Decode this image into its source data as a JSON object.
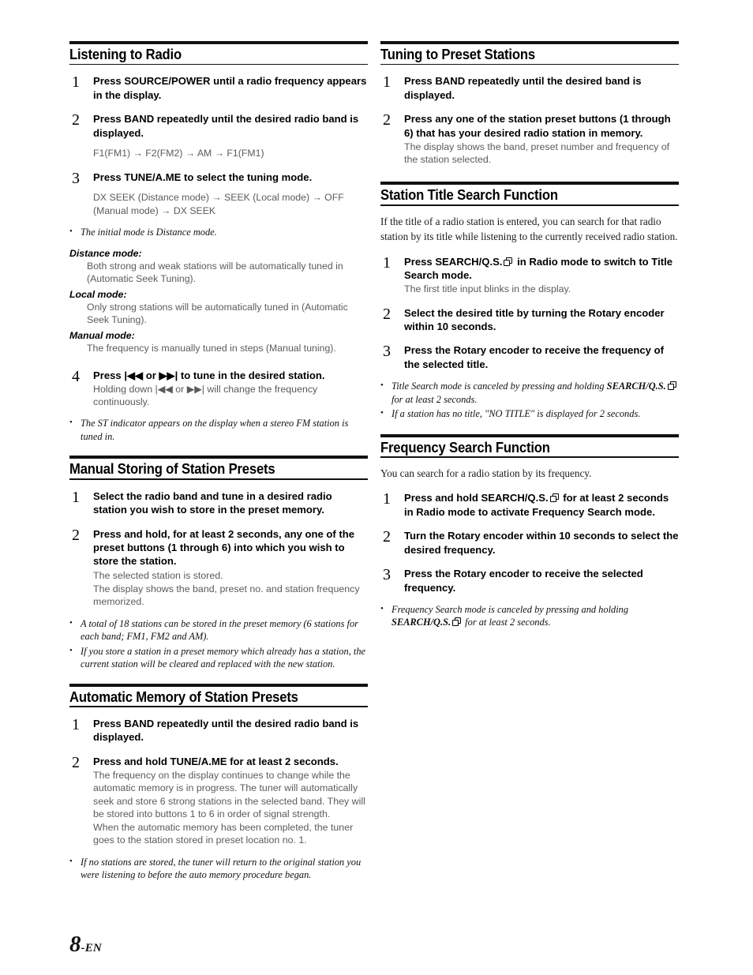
{
  "page": {
    "number": "8",
    "suffix": "-EN"
  },
  "icons": {
    "search_qs": "stacked-pages-icon"
  },
  "left": {
    "sections": [
      {
        "heading": "Listening to Radio",
        "steps": [
          {
            "num": "1",
            "lead_pre": "Press ",
            "lead_bold": "SOURCE/POWER",
            "lead_post": " until a radio frequency appears in the display.",
            "subs": []
          },
          {
            "num": "2",
            "lead_pre": "Press ",
            "lead_bold": "BAND",
            "lead_post": " repeatedly until the desired radio band is displayed.",
            "sequence": "F1(FM1) → F2(FM2) → AM → F1(FM1)"
          },
          {
            "num": "3",
            "lead_pre": "Press ",
            "lead_bold": "TUNE/A.ME",
            "lead_post": " to select the tuning mode.",
            "sequence": "DX SEEK (Distance mode) → SEEK (Local mode) → OFF (Manual mode) → DX SEEK"
          }
        ],
        "note_after_3": "The initial mode is Distance mode.",
        "modes": [
          {
            "title": "Distance mode:",
            "desc": "Both strong and weak stations will be automatically tuned in (Automatic Seek Tuning)."
          },
          {
            "title": "Local mode:",
            "desc": "Only strong stations will be automatically tuned in (Automatic Seek Tuning)."
          },
          {
            "title": "Manual mode:",
            "desc": "The frequency is manually tuned in steps (Manual tuning)."
          }
        ],
        "step4": {
          "num": "4",
          "lead": "Press |◀◀ or ▶▶| to tune in the desired station.",
          "sub": "Holding down |◀◀ or ▶▶| will change the frequency continuously."
        },
        "notes_end": [
          "The ST indicator appears on the display when a stereo FM station is tuned in."
        ]
      },
      {
        "heading": "Manual Storing of Station Presets",
        "steps": [
          {
            "num": "1",
            "lead_plain": "Select the radio band and tune in a desired radio station you wish to store in the preset memory."
          },
          {
            "num": "2",
            "lead_pre": "Press and hold, for at least 2 seconds, any one of the ",
            "lead_bold": "preset buttons (1 through 6)",
            "lead_post": " into which you wish to store the station.",
            "subs": [
              "The selected station is stored.",
              "The display shows the band, preset no. and station frequency memorized."
            ]
          }
        ],
        "notes_end": [
          "A total of 18 stations can be stored in the preset memory (6 stations for each band; FM1, FM2 and AM).",
          "If you store a station in a preset memory which already has a station, the current station will be cleared and replaced with the new station."
        ]
      },
      {
        "heading": "Automatic Memory of Station Presets",
        "steps": [
          {
            "num": "1",
            "lead_pre": "Press ",
            "lead_bold": "BAND",
            "lead_post": " repeatedly until the desired radio band is displayed."
          },
          {
            "num": "2",
            "lead_pre": "Press and hold ",
            "lead_bold": "TUNE/A.ME",
            "lead_post": " for at least 2 seconds.",
            "subs": [
              "The frequency on the display continues to change while the automatic memory is in progress. The tuner will automatically seek and store 6 strong stations in the selected band. They will be stored into buttons 1 to 6 in order of signal strength.",
              "When the automatic memory has been completed, the tuner goes to the station stored in preset location no. 1."
            ]
          }
        ],
        "notes_end": [
          "If no stations are stored, the tuner will return to the original station you were listening to before the auto memory procedure began."
        ]
      }
    ]
  },
  "right": {
    "sections": [
      {
        "heading": "Tuning to Preset Stations",
        "steps": [
          {
            "num": "1",
            "lead_pre": "Press ",
            "lead_bold": "BAND",
            "lead_post": " repeatedly until the desired band is displayed."
          },
          {
            "num": "2",
            "lead_pre": "Press any one of the station ",
            "lead_bold": "preset buttons (1 through 6)",
            "lead_post": " that has your desired radio station in memory.",
            "subs": [
              "The display shows the band, preset number and frequency of the station selected."
            ]
          }
        ]
      },
      {
        "heading": "Station Title Search Function",
        "intro": "If the title of a radio station is entered, you can search for that radio station by its title while listening to the currently received radio station.",
        "steps": [
          {
            "num": "1",
            "lead_pre": "Press ",
            "lead_bold": "SEARCH/Q.S.",
            "has_icon": true,
            "lead_post": " in Radio mode to switch to Title Search mode.",
            "subs": [
              "The first title input blinks in the display."
            ]
          },
          {
            "num": "2",
            "lead_pre": "Select the desired title by turning the ",
            "lead_bold": "Rotary encoder",
            "lead_post": " within 10 seconds."
          },
          {
            "num": "3",
            "lead_pre": "Press the ",
            "lead_bold": "Rotary encoder",
            "lead_post": " to receive the frequency of the selected title."
          }
        ],
        "notes_end": [
          {
            "pre": "Title Search mode is canceled by pressing and holding ",
            "bold": "SEARCH/Q.S.",
            "icon": true,
            "post": " for at least 2 seconds."
          },
          {
            "pre": "If a station has no title, \"NO TITLE\" is displayed for 2 seconds.",
            "bold": "",
            "icon": false,
            "post": ""
          }
        ]
      },
      {
        "heading": "Frequency Search Function",
        "intro": "You can search for a radio station by its frequency.",
        "steps": [
          {
            "num": "1",
            "lead_pre": "Press and hold ",
            "lead_bold": "SEARCH/Q.S.",
            "has_icon": true,
            "lead_post": " for at least 2 seconds in Radio mode to activate Frequency Search mode."
          },
          {
            "num": "2",
            "lead_pre": "Turn the ",
            "lead_bold": "Rotary encoder",
            "lead_post": " within 10 seconds to select the desired frequency."
          },
          {
            "num": "3",
            "lead_pre": "Press the ",
            "lead_bold": "Rotary encoder",
            "lead_post": " to receive the selected frequency."
          }
        ],
        "notes_end": [
          {
            "pre": "Frequency Search mode is canceled by pressing and holding ",
            "bold": "SEARCH/Q.S.",
            "icon": true,
            "post": " for at least 2 seconds."
          }
        ]
      }
    ]
  }
}
